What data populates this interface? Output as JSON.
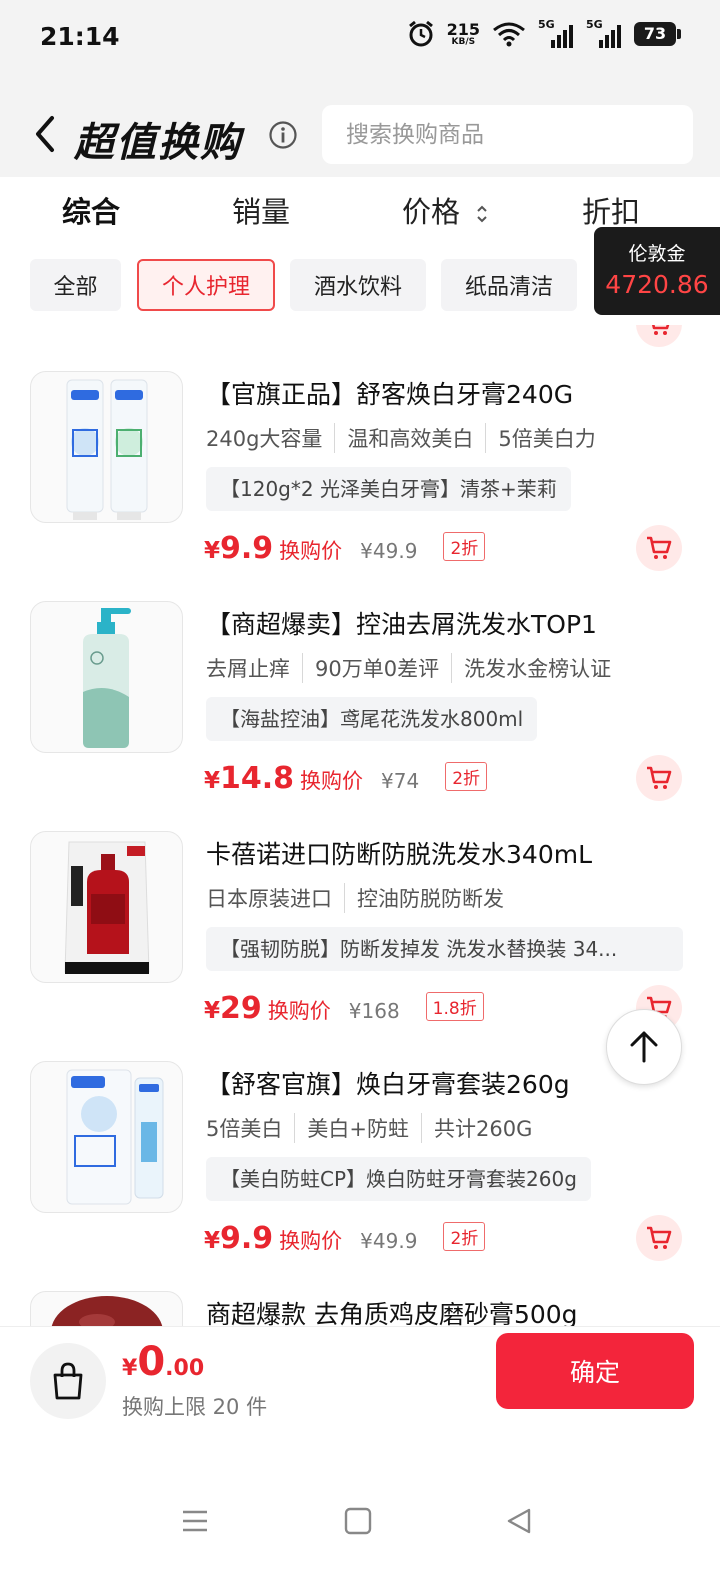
{
  "status_bar": {
    "time": "21:14",
    "net_speed": "215",
    "net_unit": "KB/S",
    "sim1": "5G",
    "sim2": "5G",
    "battery": "73"
  },
  "header": {
    "title": "超值换购",
    "search_placeholder": "搜索换购商品"
  },
  "sort_tabs": [
    {
      "label": "综合",
      "active": true
    },
    {
      "label": "销量",
      "active": false
    },
    {
      "label": "价格",
      "active": false
    },
    {
      "label": "折扣",
      "active": false
    }
  ],
  "categories": [
    {
      "label": "全部",
      "active": false
    },
    {
      "label": "个人护理",
      "active": true
    },
    {
      "label": "酒水饮料",
      "active": false
    },
    {
      "label": "纸品清洁",
      "active": false
    }
  ],
  "balance": {
    "label": "伦敦金",
    "value": "4720.86"
  },
  "products": [
    {
      "title": "【官旗正品】舒客焕白牙膏240G",
      "tags": [
        "240g大容量",
        "温和高效美白",
        "5倍美白力"
      ],
      "spec": "【120g*2 光泽美白牙膏】清茶+茉莉",
      "price": "9.9",
      "price_label": "换购价",
      "original_price": "¥49.9",
      "discount": "2折"
    },
    {
      "title": "【商超爆卖】控油去屑洗发水TOP1",
      "tags": [
        "去屑止痒",
        "90万单0差评",
        "洗发水金榜认证"
      ],
      "spec": "【海盐控油】鸢尾花洗发水800ml",
      "price": "14.8",
      "price_label": "换购价",
      "original_price": "¥74",
      "discount": "2折"
    },
    {
      "title": "卡蓓诺进口防断防脱洗发水340mL",
      "tags": [
        "日本原装进口",
        "控油防脱防断发"
      ],
      "spec": "【强韧防脱】防断发掉发 洗发水替换装 34...",
      "price": "29",
      "price_label": "换购价",
      "original_price": "¥168",
      "discount": "1.8折"
    },
    {
      "title": "【舒客官旗】焕白牙膏套装260g",
      "tags": [
        "5倍美白",
        "美白+防蛀",
        "共计260G"
      ],
      "spec": "【美白防蛀CP】焕白防蛀牙膏套装260g",
      "price": "9.9",
      "price_label": "换购价",
      "original_price": "¥49.9",
      "discount": "2折"
    },
    {
      "title": "商超爆款 去角质鸡皮磨砂膏500g"
    }
  ],
  "currency_symbol": "¥",
  "bottom_bar": {
    "currency": "¥",
    "total_int": "0",
    "total_dec": ".00",
    "limit_text": "换购上限 20 件",
    "confirm_label": "确定"
  },
  "colors": {
    "accent": "#e8262f",
    "confirm_bg": "#f3253b",
    "balance_bg": "#1b1b1b"
  }
}
